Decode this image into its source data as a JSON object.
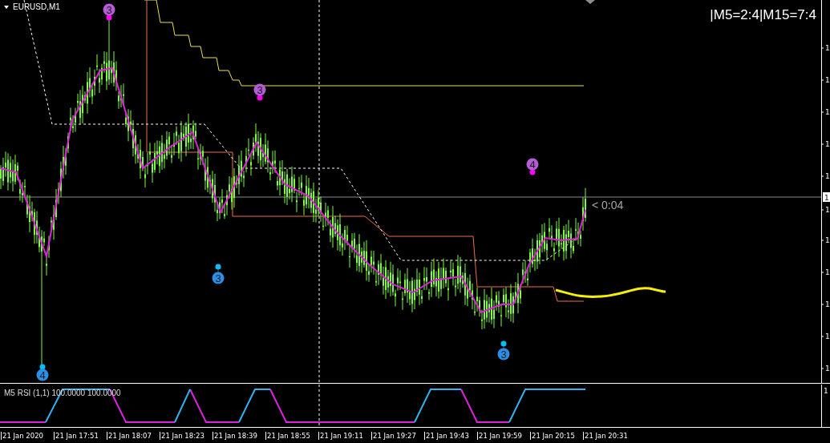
{
  "chart": {
    "symbol": "EURUSD,M1",
    "info": "|M5=2:4|M15=7:4",
    "countdown": "< 0:04",
    "markers": [
      {
        "label": "3",
        "kind": "top"
      },
      {
        "label": "3",
        "kind": "top"
      },
      {
        "label": "4",
        "kind": "top"
      },
      {
        "label": "3",
        "kind": "bottom"
      },
      {
        "label": "3",
        "kind": "bottom"
      },
      {
        "label": "4",
        "kind": "bottom"
      }
    ],
    "price_axis": {
      "labels": [
        "1",
        "1",
        "1",
        "1",
        "1",
        "1",
        "1",
        "1",
        "1",
        "1",
        "1"
      ],
      "current_price": "1"
    }
  },
  "indicator": {
    "title": "M5 RSI (1,1) 100.0000 100.0000",
    "axis_labels": [
      "1"
    ]
  },
  "time_axis": [
    "21 Jan 2020",
    "21 Jan 17:51",
    "21 Jan 18:07",
    "21 Jan 18:23",
    "21 Jan 18:39",
    "21 Jan 18:55",
    "21 Jan 19:11",
    "21 Jan 19:27",
    "21 Jan 19:43",
    "21 Jan 19:59",
    "21 Jan 20:15",
    "21 Jan 20:31"
  ]
}
